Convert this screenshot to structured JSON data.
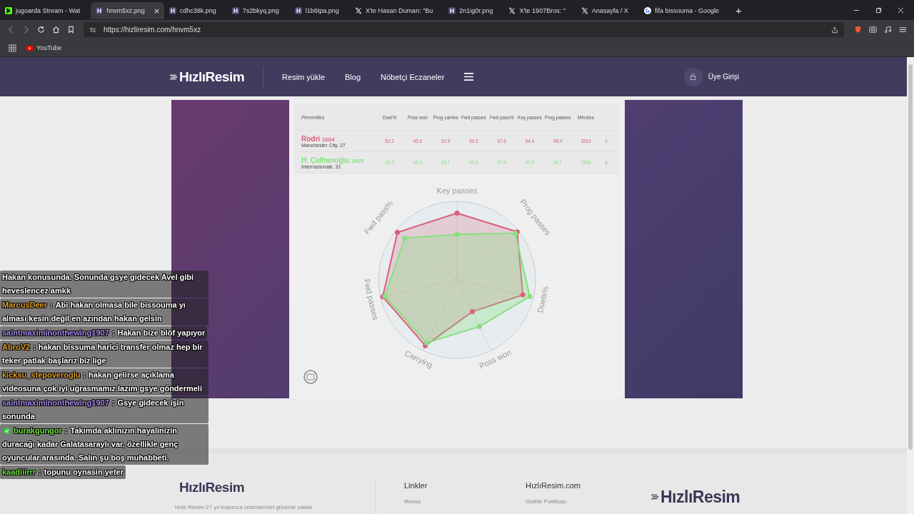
{
  "browser": {
    "tabs": [
      {
        "kind": "kick",
        "label": "jugoarda Stream - Wat",
        "selected": false
      },
      {
        "kind": "h",
        "label": "hnvm5xz.png",
        "selected": true
      },
      {
        "kind": "h",
        "label": "cdhc38k.png",
        "selected": false
      },
      {
        "kind": "h",
        "label": "7s2bkyq.png",
        "selected": false
      },
      {
        "kind": "h",
        "label": "l1b6tpa.png",
        "selected": false
      },
      {
        "kind": "x",
        "label": "X'te Hasan Duman: \"Bu",
        "selected": false
      },
      {
        "kind": "h",
        "label": "2n1ig0r.png",
        "selected": false
      },
      {
        "kind": "x",
        "label": "X'te 1907Bros: \"",
        "selected": false
      },
      {
        "kind": "x",
        "label": "Anasayfa / X",
        "selected": false
      },
      {
        "kind": "g",
        "label": "fifa bissouma - Google",
        "selected": false
      }
    ],
    "new_tab": "+",
    "url": "https://hizliresim.com/hnvm5xz",
    "bookmarks": [
      "YouTube"
    ]
  },
  "site_header": {
    "logo": "HızlıResim",
    "nav": [
      "Resim yükle",
      "Blog",
      "Nöbetçi Eczaneler"
    ],
    "login": "Üye Girişi"
  },
  "image": {
    "table": {
      "columns": [
        "Percentiles",
        "Duel%",
        "Poss won",
        "Prog carries",
        "Fwd passes",
        "Fwd pass%",
        "Key passes",
        "Prog passes",
        "Minutes"
      ],
      "rows": [
        {
          "name": "Rodri",
          "season": "23/24",
          "club": "Manchester City, 27",
          "color": "#d9607a",
          "values": [
            "82.2",
            "45.6",
            "92.9",
            "99.5",
            "97.6",
            "84.4",
            "98.4",
            "3263"
          ],
          "remove": "x"
        },
        {
          "name": "H. Çalhanoğlu",
          "season": "24/25",
          "club": "Internazionale, 31",
          "color": "#86e07e",
          "values": [
            "89.5",
            "65.4",
            "89.1",
            "94.5",
            "87.9",
            "57.6",
            "96.1",
            "2909"
          ],
          "remove": "x"
        }
      ]
    },
    "radar": {
      "axis_labels": [
        "Key passes",
        "Prog passes",
        "Duels%",
        "Poss won",
        "Carrying",
        "Fwd passes",
        "Fwd pass%"
      ]
    }
  },
  "chat": [
    {
      "kind": "cont",
      "text": "Hakan konusunda. Sonunda gsye gidecek Avel gibi heveslencez amkk"
    },
    {
      "kind": "msg",
      "user": "MarcusDeer",
      "color": "#e0a030",
      "sep": ":",
      "text": "Abi hakan olmasa bile bissouma yı alması kesin değil en azından hakan gelsin"
    },
    {
      "kind": "msg",
      "user": "saintmaximinonthewing1907",
      "color": "#a58ae8",
      "sep": ":",
      "text": "Hakan bize blöf yapıyor"
    },
    {
      "kind": "msg",
      "user": "AbroV2",
      "color": "#e0a030",
      "sep": ":",
      "text": "hakan bissuma harici transfer olmaz hep bir teker patlak başlarız biz lige"
    },
    {
      "kind": "msg",
      "user": "kicksu_stepoveroglu",
      "color": "#e0a030",
      "sep": ":",
      "text": "hakan gelirse açıklama videosuna çok iyi uğrasmamız lazım gsye göndermeli"
    },
    {
      "kind": "msg",
      "user": "saintmaximinonthewing1907",
      "color": "#a58ae8",
      "sep": ":",
      "text": "Gsye gidecek işin sonunda"
    },
    {
      "kind": "msg",
      "user": "burakgungor",
      "color": "#6fe040",
      "verified": true,
      "sep": ":",
      "text": "Takımda aklınızın hayalinizin duracağı kadar Galatasaraylı var, özellikle genç oyuncular arasında. Salın şu boş muhabbeti."
    },
    {
      "kind": "msg",
      "user": "kaadiiirrr",
      "color": "#6fe040",
      "sep": ":",
      "text": "topunu oynasin yeter"
    }
  ],
  "footer": {
    "logo": "HızlıResim",
    "about": "Hızlı Resim 27 yıl boyunca resimlerinizi güvenle saklar",
    "columns": [
      {
        "title": "Linkler",
        "items": [
          "fitness"
        ]
      },
      {
        "title": "HızlıResim.com",
        "items": [
          "Gizlilik Politikası"
        ]
      }
    ],
    "logo_large": "HızlıResim"
  }
}
